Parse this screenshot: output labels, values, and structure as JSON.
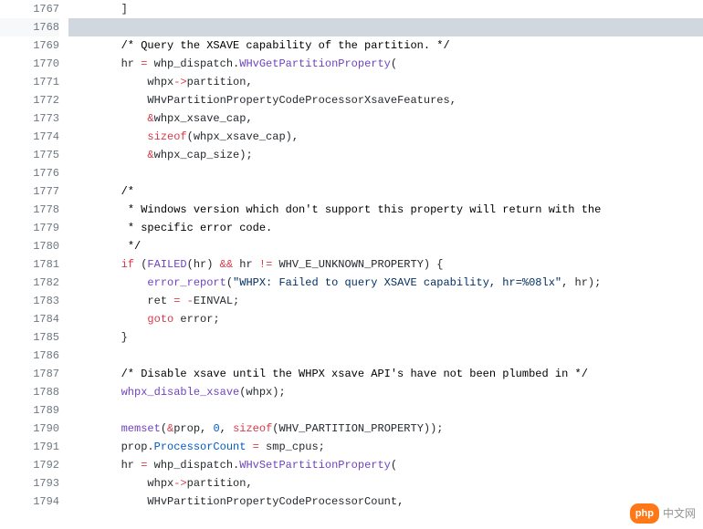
{
  "gutter": {
    "start": 1767,
    "end": 1794,
    "highlighted": 1768
  },
  "lines": [
    {
      "n": 1767,
      "indent": "        ",
      "tokens": [
        {
          "t": "]",
          "c": "tok-black"
        }
      ]
    },
    {
      "n": 1768,
      "indent": "",
      "tokens": [],
      "hl": true
    },
    {
      "n": 1769,
      "indent": "        ",
      "tokens": [
        {
          "t": "/* Query the XSAVE capability of the partition. */",
          "c": "cm"
        }
      ]
    },
    {
      "n": 1770,
      "indent": "        ",
      "tokens": [
        {
          "t": "hr ",
          "c": "tok-black"
        },
        {
          "t": "=",
          "c": "tok-red"
        },
        {
          "t": " whp_dispatch",
          "c": "tok-black"
        },
        {
          "t": ".",
          "c": "tok-black"
        },
        {
          "t": "WHvGetPartitionProperty",
          "c": "tok-purple"
        },
        {
          "t": "(",
          "c": "tok-black"
        }
      ]
    },
    {
      "n": 1771,
      "indent": "            ",
      "tokens": [
        {
          "t": "whpx",
          "c": "tok-black"
        },
        {
          "t": "->",
          "c": "tok-red"
        },
        {
          "t": "partition",
          "c": "tok-black"
        },
        {
          "t": ",",
          "c": "tok-black"
        }
      ]
    },
    {
      "n": 1772,
      "indent": "            ",
      "tokens": [
        {
          "t": "WHvPartitionPropertyCodeProcessorXsaveFeatures",
          "c": "tok-black"
        },
        {
          "t": ",",
          "c": "tok-black"
        }
      ]
    },
    {
      "n": 1773,
      "indent": "            ",
      "tokens": [
        {
          "t": "&",
          "c": "tok-red"
        },
        {
          "t": "whpx_xsave_cap",
          "c": "tok-black"
        },
        {
          "t": ",",
          "c": "tok-black"
        }
      ]
    },
    {
      "n": 1774,
      "indent": "            ",
      "tokens": [
        {
          "t": "sizeof",
          "c": "tok-red"
        },
        {
          "t": "(whpx_xsave_cap)",
          "c": "tok-black"
        },
        {
          "t": ",",
          "c": "tok-black"
        }
      ]
    },
    {
      "n": 1775,
      "indent": "            ",
      "tokens": [
        {
          "t": "&",
          "c": "tok-red"
        },
        {
          "t": "whpx_cap_size",
          "c": "tok-black"
        },
        {
          "t": ");",
          "c": "tok-black"
        }
      ]
    },
    {
      "n": 1776,
      "indent": "",
      "tokens": []
    },
    {
      "n": 1777,
      "indent": "        ",
      "tokens": [
        {
          "t": "/*",
          "c": "cm"
        }
      ]
    },
    {
      "n": 1778,
      "indent": "         ",
      "tokens": [
        {
          "t": "* Windows version which don't support this property will return with the",
          "c": "cm"
        }
      ]
    },
    {
      "n": 1779,
      "indent": "         ",
      "tokens": [
        {
          "t": "* specific error code.",
          "c": "cm"
        }
      ]
    },
    {
      "n": 1780,
      "indent": "         ",
      "tokens": [
        {
          "t": "*/",
          "c": "cm"
        }
      ]
    },
    {
      "n": 1781,
      "indent": "        ",
      "tokens": [
        {
          "t": "if",
          "c": "tok-red"
        },
        {
          "t": " (",
          "c": "tok-black"
        },
        {
          "t": "FAILED",
          "c": "tok-purple"
        },
        {
          "t": "(hr) ",
          "c": "tok-black"
        },
        {
          "t": "&&",
          "c": "tok-red"
        },
        {
          "t": " hr ",
          "c": "tok-black"
        },
        {
          "t": "!=",
          "c": "tok-red"
        },
        {
          "t": " WHV_E_UNKNOWN_PROPERTY) {",
          "c": "tok-black"
        }
      ]
    },
    {
      "n": 1782,
      "indent": "            ",
      "tokens": [
        {
          "t": "error_report",
          "c": "tok-purple"
        },
        {
          "t": "(",
          "c": "tok-black"
        },
        {
          "t": "\"WHPX: Failed to query XSAVE capability, hr=%08lx\"",
          "c": "tok-navy"
        },
        {
          "t": ", hr);",
          "c": "tok-black"
        }
      ]
    },
    {
      "n": 1783,
      "indent": "            ",
      "tokens": [
        {
          "t": "ret ",
          "c": "tok-black"
        },
        {
          "t": "=",
          "c": "tok-red"
        },
        {
          "t": " ",
          "c": "tok-black"
        },
        {
          "t": "-",
          "c": "tok-red"
        },
        {
          "t": "EINVAL;",
          "c": "tok-black"
        }
      ]
    },
    {
      "n": 1784,
      "indent": "            ",
      "tokens": [
        {
          "t": "goto",
          "c": "tok-red"
        },
        {
          "t": " error;",
          "c": "tok-black"
        }
      ]
    },
    {
      "n": 1785,
      "indent": "        ",
      "tokens": [
        {
          "t": "}",
          "c": "tok-black"
        }
      ]
    },
    {
      "n": 1786,
      "indent": "",
      "tokens": []
    },
    {
      "n": 1787,
      "indent": "        ",
      "tokens": [
        {
          "t": "/* Disable xsave until the WHPX xsave API's have not been plumbed in */",
          "c": "cm"
        }
      ]
    },
    {
      "n": 1788,
      "indent": "        ",
      "tokens": [
        {
          "t": "whpx_disable_xsave",
          "c": "tok-purple"
        },
        {
          "t": "(whpx);",
          "c": "tok-black"
        }
      ]
    },
    {
      "n": 1789,
      "indent": "",
      "tokens": []
    },
    {
      "n": 1790,
      "indent": "        ",
      "tokens": [
        {
          "t": "memset",
          "c": "tok-purple"
        },
        {
          "t": "(",
          "c": "tok-black"
        },
        {
          "t": "&",
          "c": "tok-red"
        },
        {
          "t": "prop, ",
          "c": "tok-black"
        },
        {
          "t": "0",
          "c": "tok-blue"
        },
        {
          "t": ", ",
          "c": "tok-black"
        },
        {
          "t": "sizeof",
          "c": "tok-red"
        },
        {
          "t": "(WHV_PARTITION_PROPERTY));",
          "c": "tok-black"
        }
      ]
    },
    {
      "n": 1791,
      "indent": "        ",
      "tokens": [
        {
          "t": "prop",
          "c": "tok-black"
        },
        {
          "t": ".",
          "c": "tok-black"
        },
        {
          "t": "ProcessorCount",
          "c": "tok-blue"
        },
        {
          "t": " ",
          "c": "tok-black"
        },
        {
          "t": "=",
          "c": "tok-red"
        },
        {
          "t": " smp_cpus;",
          "c": "tok-black"
        }
      ]
    },
    {
      "n": 1792,
      "indent": "        ",
      "tokens": [
        {
          "t": "hr ",
          "c": "tok-black"
        },
        {
          "t": "=",
          "c": "tok-red"
        },
        {
          "t": " whp_dispatch",
          "c": "tok-black"
        },
        {
          "t": ".",
          "c": "tok-black"
        },
        {
          "t": "WHvSetPartitionProperty",
          "c": "tok-purple"
        },
        {
          "t": "(",
          "c": "tok-black"
        }
      ]
    },
    {
      "n": 1793,
      "indent": "            ",
      "tokens": [
        {
          "t": "whpx",
          "c": "tok-black"
        },
        {
          "t": "->",
          "c": "tok-red"
        },
        {
          "t": "partition",
          "c": "tok-black"
        },
        {
          "t": ",",
          "c": "tok-black"
        }
      ]
    },
    {
      "n": 1794,
      "indent": "            ",
      "tokens": [
        {
          "t": "WHvPartitionPropertyCodeProcessorCount",
          "c": "tok-black"
        },
        {
          "t": ",",
          "c": "tok-black"
        }
      ]
    }
  ],
  "watermark": {
    "badge": "php",
    "text": "中文网"
  }
}
